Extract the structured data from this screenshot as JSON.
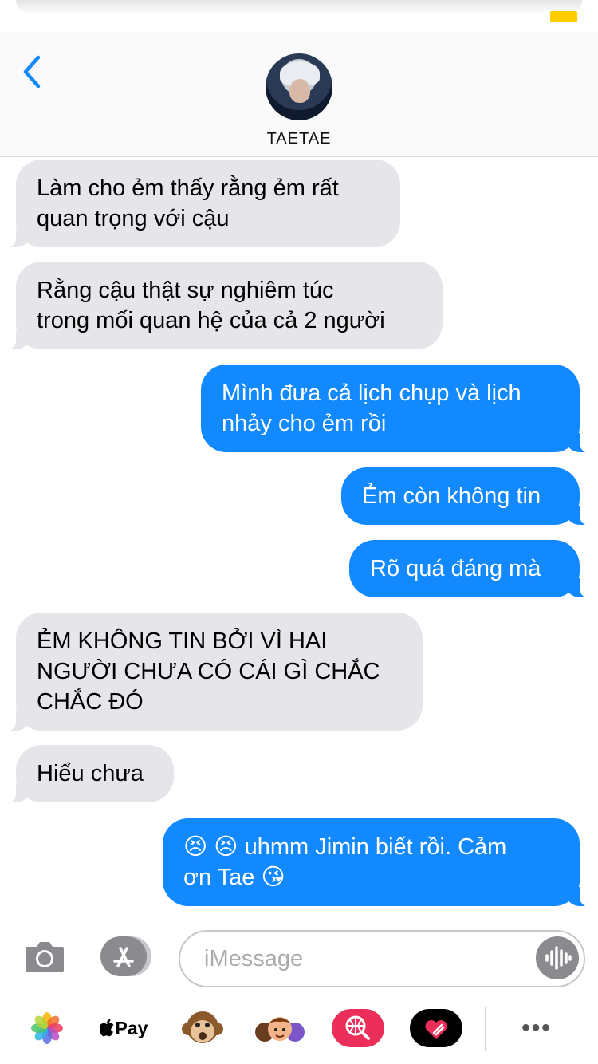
{
  "header": {
    "contact_name": "TAETAE"
  },
  "messages": [
    {
      "side": "in",
      "text": "Làm cho ẻm thấy rằng ẻm rất\nquan trọng với cậu"
    },
    {
      "side": "in",
      "text": "Rằng cậu thật sự nghiêm túc\ntrong mối quan hệ của cả 2 người"
    },
    {
      "side": "out",
      "text": "Mình đưa cả lịch chụp và lịch\nnhảy cho ẻm rồi"
    },
    {
      "side": "out",
      "text": "Ẻm còn không tin"
    },
    {
      "side": "out",
      "text": "Rõ quá đáng mà"
    },
    {
      "side": "in",
      "text": "ẺM KHÔNG TIN BỞI VÌ HAI\nNGƯỜI CHƯA CÓ CÁI GÌ CHẮC\nCHẮC ĐÓ"
    },
    {
      "side": "in",
      "text": "Hiểu chưa"
    },
    {
      "side": "out",
      "text": "😣 😣 uhmm Jimin biết rồi. Cảm\nơn Tae 😘"
    }
  ],
  "composer": {
    "placeholder": "iMessage"
  },
  "app_drawer": {
    "apple_pay_label": "Pay",
    "more_label": "•••"
  },
  "colors": {
    "bubble_in": "#e5e5ea",
    "bubble_out": "#1289fe",
    "accent": "#1289fe",
    "battery": "#ffcc00"
  },
  "icons": [
    "chevron-left-icon",
    "camera-icon",
    "app-store-icon",
    "audio-wave-icon",
    "photos-icon",
    "apple-icon",
    "monkey-memoji-icon",
    "memoji-stickers-icon",
    "web-search-icon",
    "digital-touch-icon",
    "more-icon"
  ]
}
